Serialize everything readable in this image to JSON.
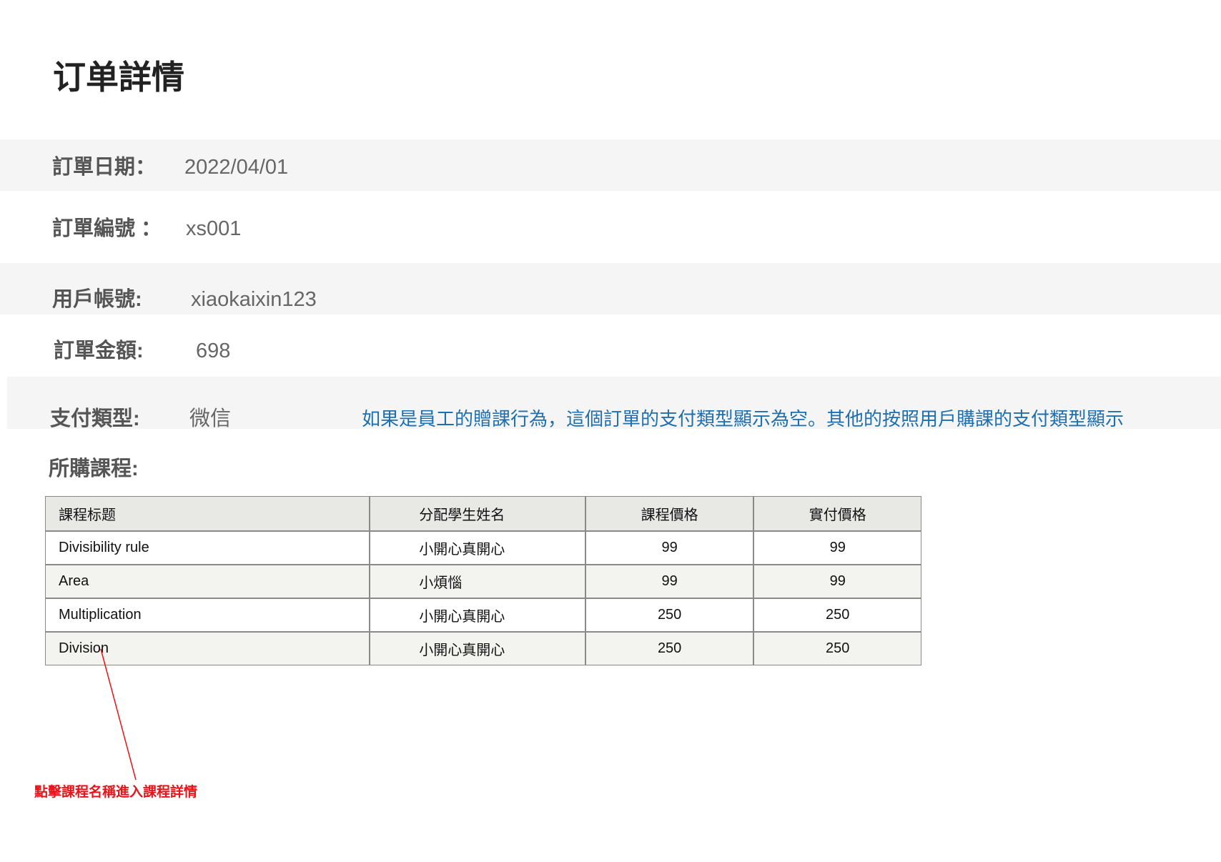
{
  "page": {
    "title": "订单詳情"
  },
  "order": {
    "date": {
      "label": "訂單日期：",
      "value": "2022/04/01"
    },
    "number": {
      "label": "訂單編號 ：",
      "value": "xs001"
    },
    "account": {
      "label": "用戶帳號:",
      "value": "xiaokaixin123"
    },
    "amount": {
      "label": "訂單金額:",
      "value": "698"
    },
    "payment": {
      "label": "支付類型:",
      "value": "微信"
    },
    "payment_note": "如果是員工的贈課行為，這個訂單的支付類型顯示為空。其他的按照用戶購課的支付類型顯示"
  },
  "courses": {
    "section_title": "所購課程:",
    "headers": [
      "課程标题",
      "分配學生姓名",
      "課程價格",
      "實付價格"
    ],
    "rows": [
      [
        "Divisibility rule",
        "小開心真開心",
        "99",
        "99"
      ],
      [
        "Area",
        "小煩惱",
        "99",
        "99"
      ],
      [
        "Multiplication",
        "小開心真開心",
        "250",
        "250"
      ],
      [
        "Division",
        "小開心真開心",
        "250",
        "250"
      ]
    ]
  },
  "annotation": {
    "text": "點擊課程名稱進入課程詳情",
    "color": "#e8141a"
  },
  "colors": {
    "band": "#f5f5f5",
    "note": "#1d6fb0",
    "table_header": "#e8e8e5",
    "table_border": "#8a8a8a"
  }
}
